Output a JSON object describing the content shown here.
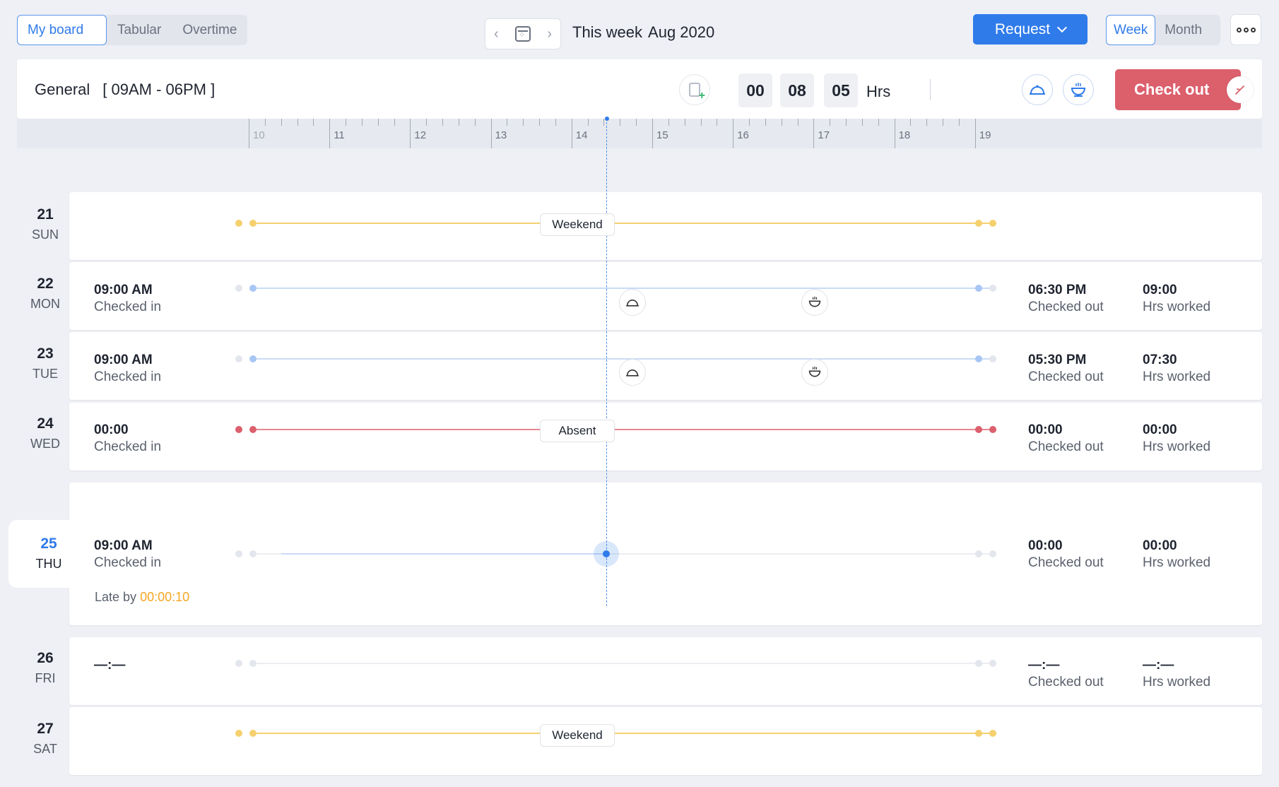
{
  "top_bar": {
    "tabs": [
      "My board",
      "Tabular",
      "Overtime"
    ],
    "nav_prev": "‹",
    "nav_next": "›",
    "period_label": "This week",
    "period_month": "Aug 2020",
    "request_label": "Request",
    "view_tabs": [
      "Week",
      "Month"
    ]
  },
  "shift": {
    "name": "General",
    "timing": "[ 09AM - 06PM ]",
    "hours": "00",
    "minutes": "08",
    "seconds": "05",
    "unit": "Hrs",
    "checkout_label": "Check out"
  },
  "ruler": {
    "labels": [
      "10",
      "11",
      "12",
      "13",
      "14",
      "15",
      "16",
      "17",
      "18",
      "19"
    ]
  },
  "colors": {
    "accent": "#2f7bea",
    "weekend": "#f5d06e",
    "absent": "#dc5f6c",
    "present": "#a8c6f4",
    "late": "#f5a623"
  },
  "days": [
    {
      "num": "21",
      "dow": "SUN",
      "status": "Weekend"
    },
    {
      "num": "22",
      "dow": "MON",
      "checkin": "09:00 AM",
      "checkin_label": "Checked in",
      "checkout": "06:30 PM",
      "checkout_label": "Checked out",
      "worked": "09:00",
      "worked_label": "Hrs  worked"
    },
    {
      "num": "23",
      "dow": "TUE",
      "checkin": "09:00 AM",
      "checkin_label": "Checked in",
      "checkout": "05:30 PM",
      "checkout_label": "Checked out",
      "worked": "07:30",
      "worked_label": "Hrs  worked"
    },
    {
      "num": "24",
      "dow": "WED",
      "status": "Absent",
      "checkin": "00:00",
      "checkin_label": "Checked in",
      "checkout": "00:00",
      "checkout_label": "Checked out",
      "worked": "00:00",
      "worked_label": "Hrs  worked"
    },
    {
      "num": "25",
      "dow": "THU",
      "checkin": "09:00 AM",
      "checkin_label": "Checked in",
      "checkout": "00:00",
      "checkout_label": "Checked out",
      "worked": "00:00",
      "worked_label": "Hrs  worked",
      "late_label": "Late by",
      "late_value": "00:00:10"
    },
    {
      "num": "26",
      "dow": "FRI",
      "checkin": "—:—",
      "checkout": "—:—",
      "checkout_label": "Checked out",
      "worked": "—:—",
      "worked_label": "Hrs  worked"
    },
    {
      "num": "27",
      "dow": "SAT",
      "status": "Weekend"
    }
  ]
}
